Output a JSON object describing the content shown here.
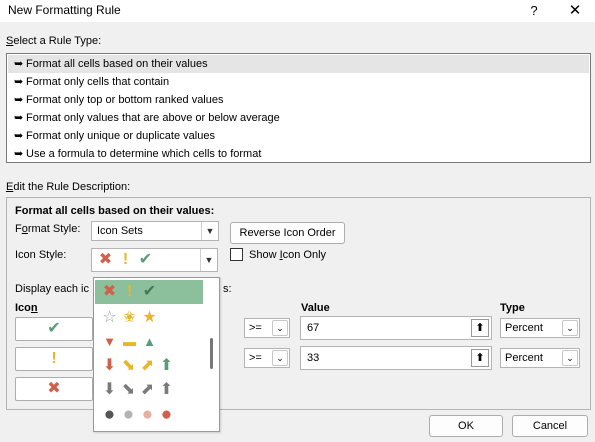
{
  "window": {
    "title": "New Formatting Rule",
    "help_glyph": "?",
    "close_glyph": "✕"
  },
  "rule_type": {
    "heading": "Select a Rule Type:",
    "heading_key": "S",
    "heading_rest": "elect a Rule Type:",
    "items": [
      "Format all cells based on their values",
      "Format only cells that contain",
      "Format only top or bottom ranked values",
      "Format only values that are above or below average",
      "Format only unique or duplicate values",
      "Use a formula to determine which cells to format"
    ],
    "selected_index": 0
  },
  "description": {
    "heading_key": "E",
    "heading_rest": "dit the Rule Description:",
    "subheading": "Format all cells based on their values:",
    "format_style_label_pre": "F",
    "format_style_label_key": "o",
    "format_style_label_post": "rmat Style:",
    "format_style_value": "Icon Sets",
    "reverse_button": "Reverse Icon Order",
    "icon_style_label": "Icon Style:",
    "show_icon_only_pre": "Show ",
    "show_icon_only_key": "I",
    "show_icon_only_post": "con Only",
    "display_each_pre": "Display each ic",
    "display_each_post": "s:",
    "col_icon_pre": "Ico",
    "col_icon_key": "n",
    "col_value": "Value",
    "col_type": "Type",
    "rows": [
      {
        "operator": ">=",
        "value": "67",
        "type": "Percent"
      },
      {
        "operator": ">=",
        "value": "33",
        "type": "Percent"
      }
    ]
  },
  "icon_style_dropdown": {
    "options": [
      {
        "icons": [
          "red-x",
          "yellow-exclamation",
          "green-check"
        ],
        "glyphs": [
          "✖",
          "!",
          "✔"
        ]
      },
      {
        "icons": [
          "star-empty",
          "star-half",
          "star-full"
        ],
        "glyphs": [
          "☆",
          "★",
          "★"
        ]
      },
      {
        "icons": [
          "red-triangle-down",
          "yellow-dash",
          "green-triangle-up"
        ],
        "glyphs": [
          "▼",
          "▬",
          "▲"
        ]
      },
      {
        "icons": [
          "red-arrow-down",
          "yellow-arrow-downright",
          "yellow-arrow-upright",
          "green-arrow-up"
        ],
        "glyphs": [
          "🡇",
          "🡖",
          "🡕",
          "🡅"
        ]
      },
      {
        "icons": [
          "gray-arrow-down",
          "gray-arrow-downright",
          "gray-arrow-upright",
          "gray-arrow-up"
        ],
        "glyphs": [
          "🡇",
          "🡖",
          "🡕",
          "🡅"
        ]
      },
      {
        "icons": [
          "dark-gray-circle",
          "light-gray-circle",
          "pink-circle",
          "red-circle"
        ],
        "glyphs": [
          "●",
          "●",
          "●",
          "●"
        ]
      }
    ],
    "selected_index": 0
  },
  "buttons": {
    "ok": "OK",
    "cancel": "Cancel"
  },
  "colors": {
    "red": "#d25f4b",
    "yellow": "#e8b62a",
    "green": "#5c9b75",
    "gray": "#7a7a7a",
    "selection_green": "#8cbf9b"
  }
}
